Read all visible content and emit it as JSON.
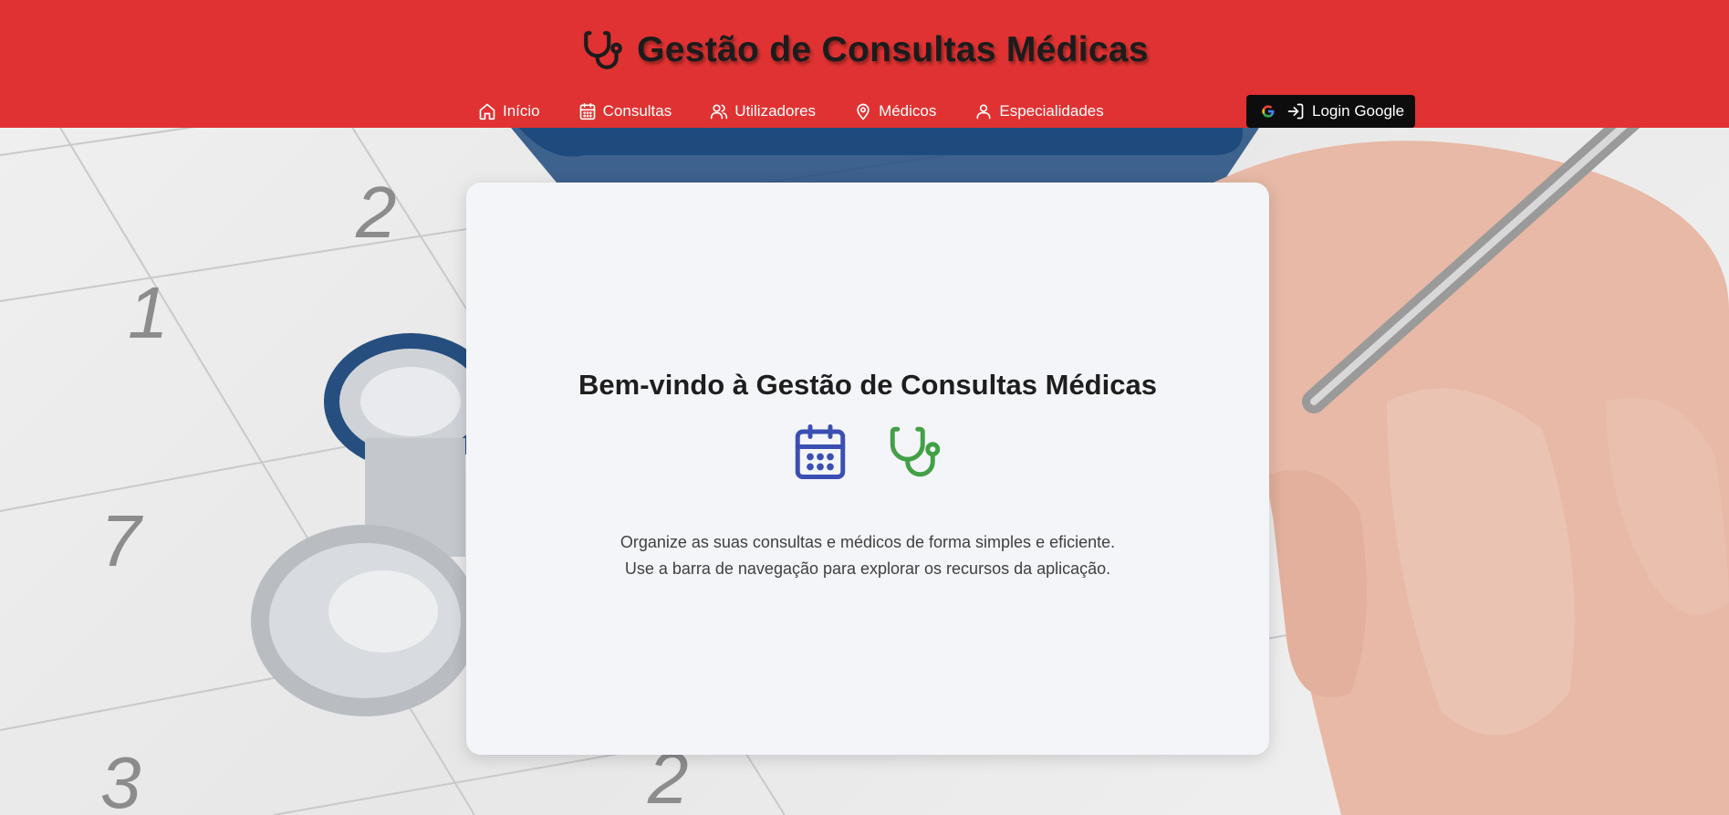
{
  "header": {
    "title": "Gestão de Consultas Médicas",
    "brand_icon": "stethoscope-icon",
    "nav": [
      {
        "label": "Início",
        "icon": "home-icon"
      },
      {
        "label": "Consultas",
        "icon": "calendar-icon"
      },
      {
        "label": "Utilizadores",
        "icon": "users-icon"
      },
      {
        "label": "Médicos",
        "icon": "map-pin-icon"
      },
      {
        "label": "Especialidades",
        "icon": "user-icon"
      }
    ],
    "login": {
      "label": "Login Google",
      "icons": [
        "google-icon",
        "login-icon"
      ]
    }
  },
  "card": {
    "title": "Bem-vindo à Gestão de Consultas Médicas",
    "icons": [
      "calendar-icon",
      "stethoscope-icon"
    ],
    "lines": [
      "Organize as suas consultas e médicos de forma simples e eficiente.",
      "Use a barra de navegação para explorar os recursos da aplicação."
    ]
  },
  "background": {
    "calendar_numbers": [
      "1",
      "2",
      "7",
      "3",
      "2"
    ]
  },
  "colors": {
    "header_bg": "#e03232",
    "calendar_icon": "#3b4fb3",
    "stethoscope_icon": "#43a047",
    "login_bg": "#0d0d0d",
    "card_bg": "#f4f5f8"
  }
}
